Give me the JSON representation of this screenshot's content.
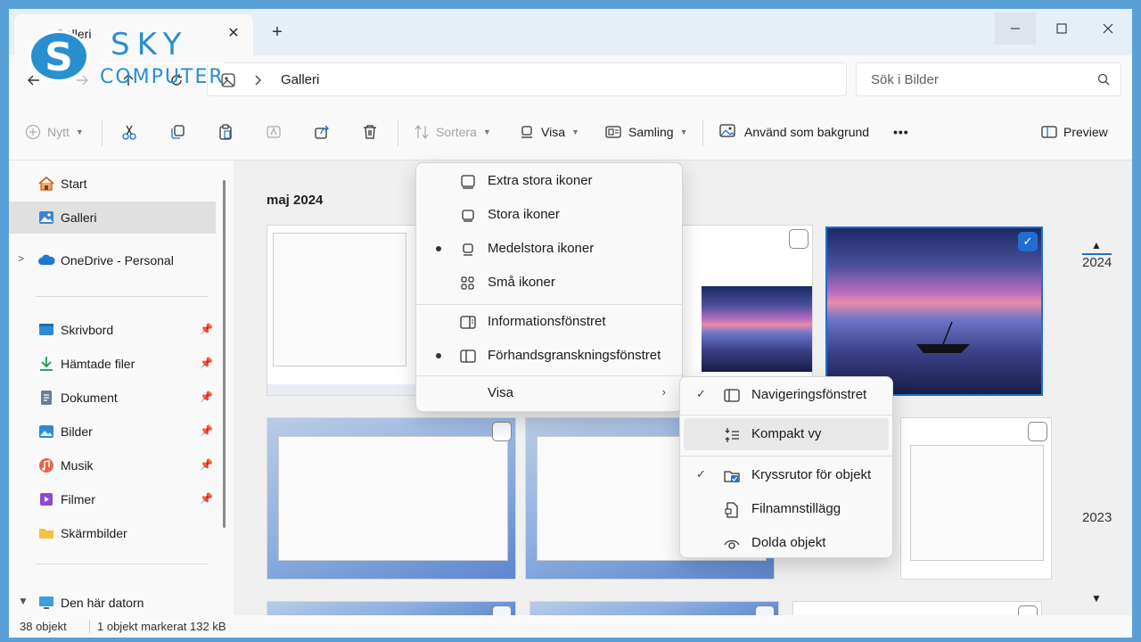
{
  "window": {
    "tab_title": "Galleri",
    "tab_close": "✕",
    "new_tab": "+",
    "btn_min": "—",
    "btn_max": "☐",
    "btn_close": "✕"
  },
  "logo": {
    "initial": "S",
    "line1": "SKY",
    "line2": "COMPUTER"
  },
  "address": {
    "location": "Galleri",
    "search_placeholder": "Sök i Bilder"
  },
  "toolbar": {
    "new": "Nytt",
    "sort": "Sortera",
    "view": "Visa",
    "collection": "Samling",
    "set_background": "Använd som bakgrund",
    "more": "•••",
    "preview": "Preview"
  },
  "sidebar": {
    "items": [
      {
        "label": "Start",
        "icon": "home-icon"
      },
      {
        "label": "Galleri",
        "icon": "gallery-icon"
      },
      {
        "label": "OneDrive - Personal",
        "icon": "cloud-icon"
      },
      {
        "label": "Skrivbord",
        "icon": "desktop-icon"
      },
      {
        "label": "Hämtade filer",
        "icon": "download-icon"
      },
      {
        "label": "Dokument",
        "icon": "document-icon"
      },
      {
        "label": "Bilder",
        "icon": "pictures-icon"
      },
      {
        "label": "Musik",
        "icon": "music-icon"
      },
      {
        "label": "Filmer",
        "icon": "video-icon"
      },
      {
        "label": "Skärmbilder",
        "icon": "folder-icon"
      },
      {
        "label": "Den här datorn",
        "icon": "computer-icon"
      }
    ]
  },
  "content": {
    "group_title": "maj 2024",
    "years": [
      "2024",
      "2023"
    ]
  },
  "status": {
    "count": "38 objekt",
    "selected": "1 objekt markerat  132 kB"
  },
  "view_menu": {
    "items": [
      {
        "label": "Extra stora ikoner",
        "selected": false
      },
      {
        "label": "Stora ikoner",
        "selected": false
      },
      {
        "label": "Medelstora ikoner",
        "selected": true
      },
      {
        "label": "Små ikoner",
        "selected": false
      },
      {
        "label": "Informationsfönstret",
        "selected": false
      },
      {
        "label": "Förhandsgranskningsfönstret",
        "selected": true
      },
      {
        "label": "Visa",
        "selected": false
      }
    ],
    "arrow": "›"
  },
  "show_submenu": {
    "items": [
      {
        "label": "Navigeringsfönstret",
        "checked": true
      },
      {
        "label": "Kompakt vy",
        "checked": false
      },
      {
        "label": "Kryssrutor för objekt",
        "checked": true
      },
      {
        "label": "Filnamnstillägg",
        "checked": false
      },
      {
        "label": "Dolda objekt",
        "checked": false
      }
    ],
    "check": "✓"
  },
  "colors": {
    "accent": "#1f6fd1",
    "brand": "#2a8fcf"
  }
}
